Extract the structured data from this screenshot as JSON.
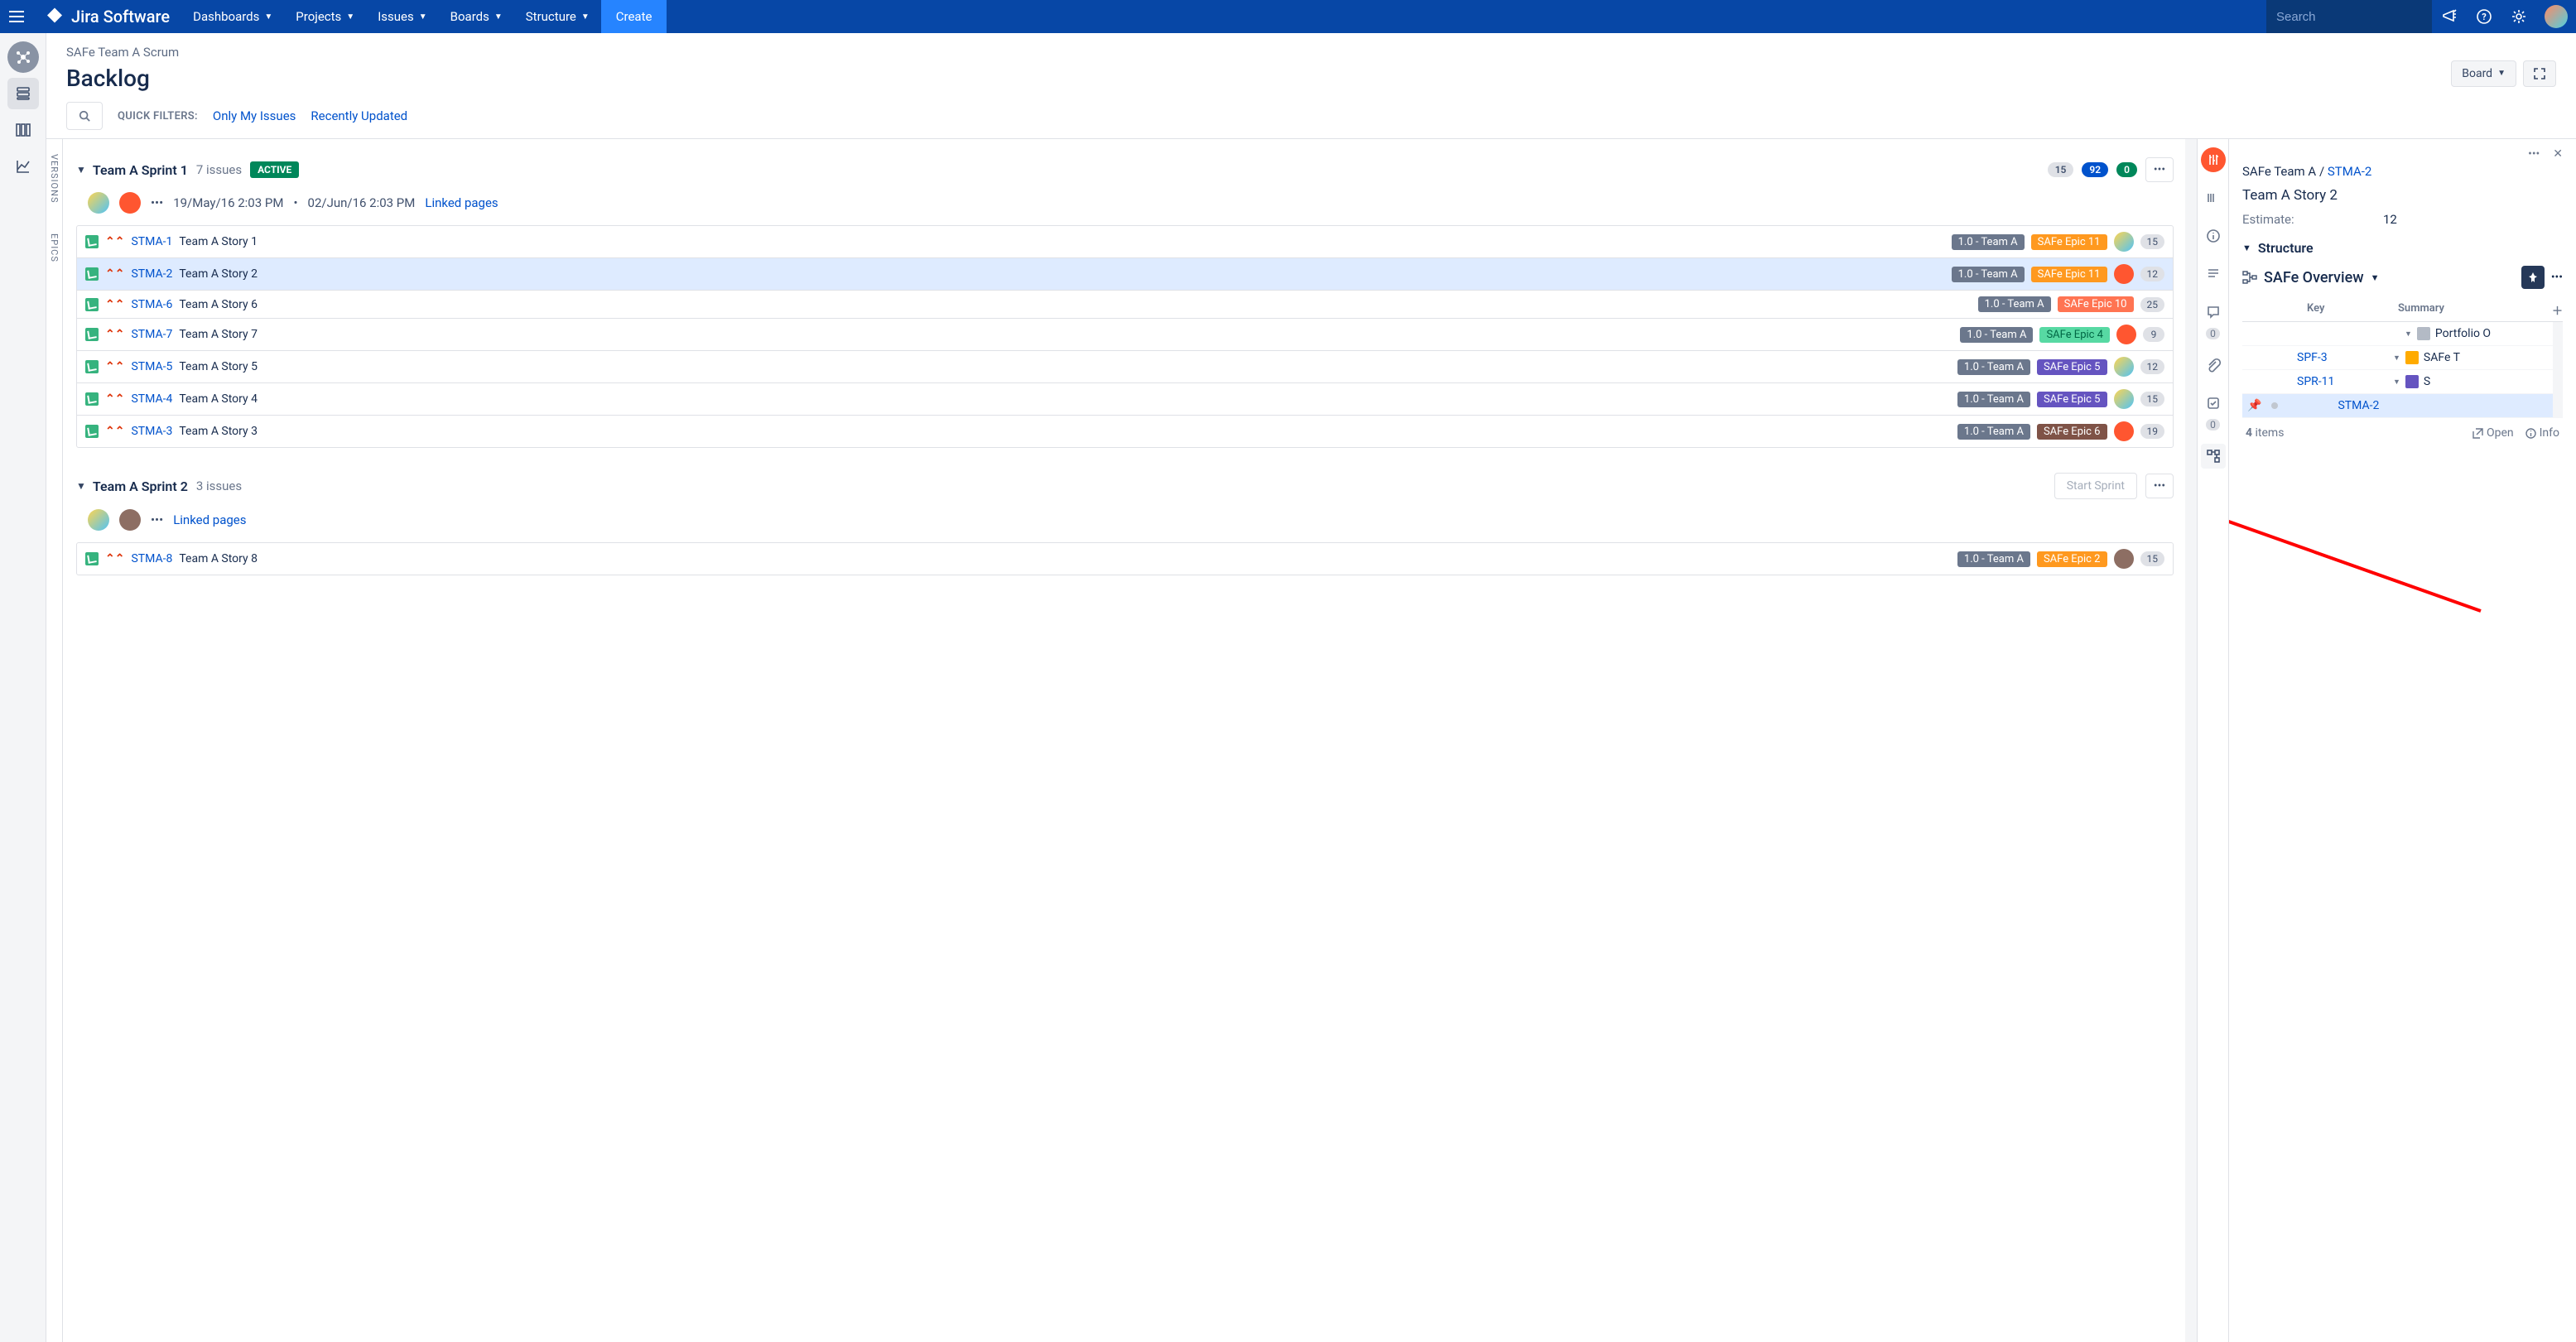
{
  "topnav": {
    "product": "Jira Software",
    "items": [
      "Dashboards",
      "Projects",
      "Issues",
      "Boards",
      "Structure"
    ],
    "create": "Create",
    "search_placeholder": "Search"
  },
  "page": {
    "project": "SAFe Team A Scrum",
    "title": "Backlog",
    "board_btn": "Board",
    "quick_filters_label": "QUICK FILTERS:",
    "quick_filters": [
      "Only My Issues",
      "Recently Updated"
    ]
  },
  "side_tabs": {
    "versions": "VERSIONS",
    "epics": "EPICS"
  },
  "sprints": [
    {
      "name": "Team A Sprint 1",
      "count_label": "7 issues",
      "active": true,
      "active_label": "ACTIVE",
      "totals": {
        "todo": "15",
        "inprog": "92",
        "done": "0"
      },
      "dates": {
        "start": "19/May/16 2:03 PM",
        "end": "02/Jun/16 2:03 PM"
      },
      "linked_pages": "Linked pages",
      "issues": [
        {
          "key": "STMA-1",
          "summary": "Team A Story 1",
          "version": "1.0 - Team A",
          "epic": "SAFe Epic 11",
          "epic_color": "orange",
          "avatar": "av1",
          "estimate": "15"
        },
        {
          "key": "STMA-2",
          "summary": "Team A Story 2",
          "version": "1.0 - Team A",
          "epic": "SAFe Epic 11",
          "epic_color": "orange",
          "avatar": "av2",
          "estimate": "12",
          "selected": true
        },
        {
          "key": "STMA-6",
          "summary": "Team A Story 6",
          "version": "1.0 - Team A",
          "epic": "SAFe Epic 10",
          "epic_color": "red",
          "avatar": "",
          "estimate": "25"
        },
        {
          "key": "STMA-7",
          "summary": "Team A Story 7",
          "version": "1.0 - Team A",
          "epic": "SAFe Epic 4",
          "epic_color": "green",
          "avatar": "av2",
          "estimate": "9"
        },
        {
          "key": "STMA-5",
          "summary": "Team A Story 5",
          "version": "1.0 - Team A",
          "epic": "SAFe Epic 5",
          "epic_color": "purple",
          "avatar": "av1",
          "estimate": "12"
        },
        {
          "key": "STMA-4",
          "summary": "Team A Story 4",
          "version": "1.0 - Team A",
          "epic": "SAFe Epic 5",
          "epic_color": "purple",
          "avatar": "av1",
          "estimate": "15"
        },
        {
          "key": "STMA-3",
          "summary": "Team A Story 3",
          "version": "1.0 - Team A",
          "epic": "SAFe Epic 6",
          "epic_color": "brown",
          "avatar": "av2",
          "estimate": "19"
        }
      ]
    },
    {
      "name": "Team A Sprint 2",
      "count_label": "3 issues",
      "active": false,
      "start_btn": "Start Sprint",
      "linked_pages": "Linked pages",
      "issues": [
        {
          "key": "STMA-8",
          "summary": "Team A Story 8",
          "version": "1.0 - Team A",
          "epic": "SAFe Epic 2",
          "epic_color": "orange",
          "avatar": "av3",
          "estimate": "15"
        }
      ]
    }
  ],
  "detail": {
    "project": "SAFe Team A",
    "key": "STMA-2",
    "title": "Team A Story 2",
    "estimate_label": "Estimate:",
    "estimate_value": "12",
    "structure_heading": "Structure",
    "structure_name": "SAFe Overview",
    "columns": {
      "key": "Key",
      "summary": "Summary"
    },
    "rows": [
      {
        "indent": 190,
        "twisty": true,
        "icon": "folder",
        "summary": "Portfolio O",
        "key": ""
      },
      {
        "indent": 66,
        "key": "SPF-3",
        "twisty": true,
        "twisty_right": true,
        "icon": "pf",
        "summary": "SAFe T"
      },
      {
        "indent": 66,
        "key": "SPR-11",
        "twisty": true,
        "twisty_right": true,
        "icon": "pr",
        "summary": "S"
      },
      {
        "indent": 66,
        "key": "STMA-2",
        "selected": true,
        "pin": true
      }
    ],
    "footer": {
      "count_num": "4",
      "count_text": " items",
      "open": "Open",
      "info": "Info"
    }
  }
}
